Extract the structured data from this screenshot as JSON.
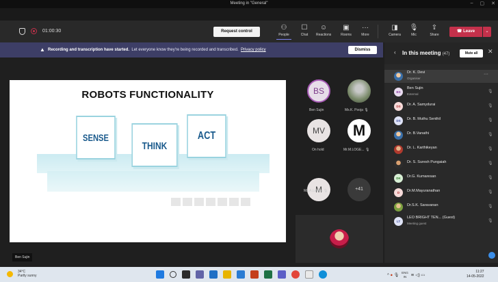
{
  "window": {
    "title": "Meeting in \"General\"",
    "controls": [
      "–",
      "▢",
      "✕"
    ]
  },
  "toolbar": {
    "timer": "01:00:30",
    "request_control": "Request control",
    "buttons": [
      {
        "label": "People",
        "icon": "people-icon"
      },
      {
        "label": "Chat",
        "icon": "chat-icon"
      },
      {
        "label": "Reactions",
        "icon": "reactions-icon"
      },
      {
        "label": "Rooms",
        "icon": "rooms-icon"
      },
      {
        "label": "More",
        "icon": "more-icon"
      },
      {
        "label": "Camera",
        "icon": "camera-off-icon"
      },
      {
        "label": "Mic",
        "icon": "mic-off-icon"
      },
      {
        "label": "Share",
        "icon": "share-icon"
      }
    ],
    "leave": "Leave"
  },
  "banner": {
    "bold": "Recording and transcription have started.",
    "text": "Let everyone know they're being recorded and transcribed.",
    "link": "Privacy policy",
    "dismiss": "Dismiss"
  },
  "slide": {
    "title": "ROBOTS FUNCTIONALITY",
    "boxes": [
      "SENSE",
      "THINK",
      "ACT"
    ]
  },
  "presenter_name": "Ben Sujin",
  "gallery": [
    {
      "initials": "BS",
      "name": "Ben Sujin"
    },
    {
      "initials": "",
      "name": "Ms.K. Pooja"
    },
    {
      "initials": "MV",
      "name": "On hold"
    },
    {
      "initials": "M",
      "name": "Mr.M.LOGE..."
    },
    {
      "initials": "M",
      "name": "Ms.A.Lalitha"
    },
    {
      "initials": "+41",
      "name": ""
    }
  ],
  "panel": {
    "title": "In this meeting",
    "count": "(47)",
    "mute_all": "Mute all",
    "participants": [
      {
        "initials": "",
        "name": "Dr. K. Devi",
        "sub": "Organiser"
      },
      {
        "initials": "BS",
        "name": "Ben Sujin",
        "sub": "External"
      },
      {
        "initials": "DS",
        "name": "Dr. A. Samydurai",
        "sub": ""
      },
      {
        "initials": "DS",
        "name": "Dr. B. Muthu Senthil",
        "sub": ""
      },
      {
        "initials": "",
        "name": "Dr. B.Vanathi",
        "sub": ""
      },
      {
        "initials": "",
        "name": "Dr. L. Karthikeyan",
        "sub": ""
      },
      {
        "initials": "",
        "name": "Dr. S. Suresh Pungaiah",
        "sub": ""
      },
      {
        "initials": "DK",
        "name": "Dr.G. Kumaresan",
        "sub": ""
      },
      {
        "initials": "D",
        "name": "Dr.M.Mayuranathan",
        "sub": ""
      },
      {
        "initials": "",
        "name": "Dr.S.K. Saravanan",
        "sub": ""
      },
      {
        "initials": "LT",
        "name": "LEO BRIGHT TEN... (Guest)",
        "sub": "Meeting guest"
      }
    ]
  },
  "taskbar": {
    "temp": "34°C",
    "weather": "Partly sunny",
    "lang1": "ENG",
    "lang2": "IN",
    "time": "11:27",
    "date": "14-05-2022"
  }
}
